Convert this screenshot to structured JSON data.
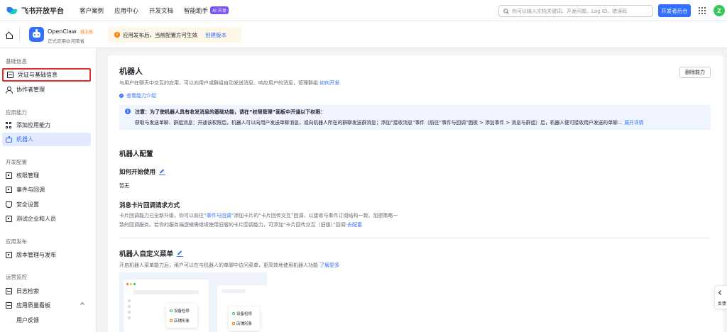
{
  "topnav": {
    "brand": "飞书开放平台",
    "items": [
      "客户案例",
      "应用中心",
      "开发文档",
      "智能助手"
    ],
    "ai_badge": "AI 开发",
    "search_placeholder": "你可以输入文档关键词、开发问题、Log ID、错误码",
    "dev_console": "开发者后台",
    "avatar_letter": "Z"
  },
  "app": {
    "name": "OpenClaw",
    "status_badge": "待上线",
    "subtitle": "正式应用@河南省",
    "notice_text": "应用发布后，当前配置方可生效",
    "notice_link": "创建版本"
  },
  "sidebar": {
    "sections": [
      {
        "title": "基础信息",
        "items": [
          {
            "label": "凭证与基础信息",
            "icon": "card-icon"
          },
          {
            "label": "协作者管理",
            "icon": "user-icon"
          }
        ]
      },
      {
        "title": "应用能力",
        "items": [
          {
            "label": "添加应用能力",
            "icon": "grid-icon"
          },
          {
            "label": "机器人",
            "icon": "robot-icon"
          }
        ]
      },
      {
        "title": "开发配置",
        "items": [
          {
            "label": "权限管理",
            "icon": "lock-icon"
          },
          {
            "label": "事件与回调",
            "icon": "event-icon"
          },
          {
            "label": "安全设置",
            "icon": "shield-icon"
          },
          {
            "label": "测试企业和人员",
            "icon": "box-icon"
          }
        ]
      },
      {
        "title": "应用发布",
        "items": [
          {
            "label": "版本管理与发布",
            "icon": "box-icon"
          }
        ]
      },
      {
        "title": "运营监控",
        "items": [
          {
            "label": "日志检索",
            "icon": "log-icon"
          },
          {
            "label": "应用质量看板",
            "icon": "chart-icon"
          },
          {
            "label": "用户反馈",
            "icon": ""
          }
        ]
      }
    ]
  },
  "main": {
    "title": "机器人",
    "delete_button": "删除能力",
    "desc": "与用户在聊天中交互的应用，可以向用户或群组自动发送消息、响应用户的消息，管理群组",
    "desc_link": "如何开发",
    "intro_link": "查看能力介绍",
    "info_line1": "注意：为了使机器人具有收发消息的基础功能，请在“权限管理”面板中开通以下权限：",
    "info_line2": "获取与发送单聊、群组消息：开通该权限后，机器人可以向用户发送单聊消息，或向机器人所在的群聊发送群消息；添加“接收消息”事件（前往“事件与回调”面板 > 添加事件 > 消息与群组）后，机器人便可接收用户发送的单聊...",
    "info_more": "展开详情",
    "config_title": "机器人配置",
    "how_to_use": "如何开始使用",
    "none_text": "暂无",
    "card_callback_title": "消息卡片回调请求方式",
    "card_callback_l1a": "卡片回调能力已全新升级，你可以前往“",
    "card_callback_l1_link": "事件与回调",
    "card_callback_l1b": "”添加卡片的“卡片回传交互”回调，以接收与事件订阅结构一致、加密策略一",
    "card_callback_l2": "致的回调服务。若你的服务端逻辑需继续使用旧版的卡片回调能力，可添加“卡片回传交互（旧版）”回调",
    "card_callback_l2_link": "去配置",
    "menu_title": "机器人自定义菜单",
    "menu_desc": "开启机器人菜单能力后，用户可以在与机器人的单聊中访问菜单，更高效地使用机器人功能",
    "menu_link": "了解更多",
    "illus_item1": "设备检修",
    "illus_item2": "店铺形象"
  },
  "feedback": "反馈",
  "colors": {
    "accent": "#3370ff",
    "warning": "#ff7d00",
    "highlight_outline": "#e02e2e"
  }
}
